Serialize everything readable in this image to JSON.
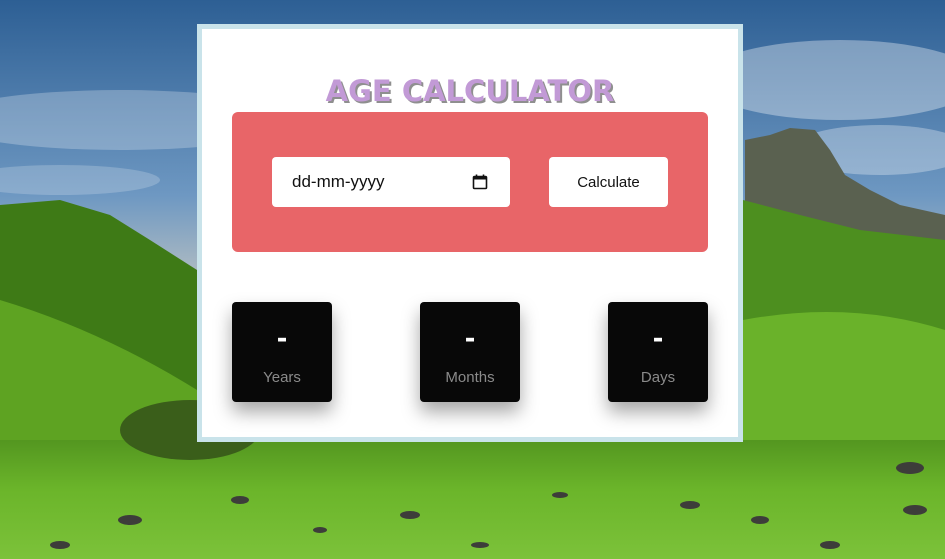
{
  "title": "AGE CALCULATOR",
  "date_input": {
    "placeholder": "dd-mm-yyyy",
    "icon": "calendar-icon"
  },
  "calculate_button": "Calculate",
  "results": {
    "years": {
      "value": "-",
      "label": "Years"
    },
    "months": {
      "value": "-",
      "label": "Months"
    },
    "days": {
      "value": "-",
      "label": "Days"
    }
  },
  "colors": {
    "panel": "#e86568",
    "card_border": "#c9e3ea",
    "title": "#c29ad6",
    "result_box": "#080808"
  }
}
